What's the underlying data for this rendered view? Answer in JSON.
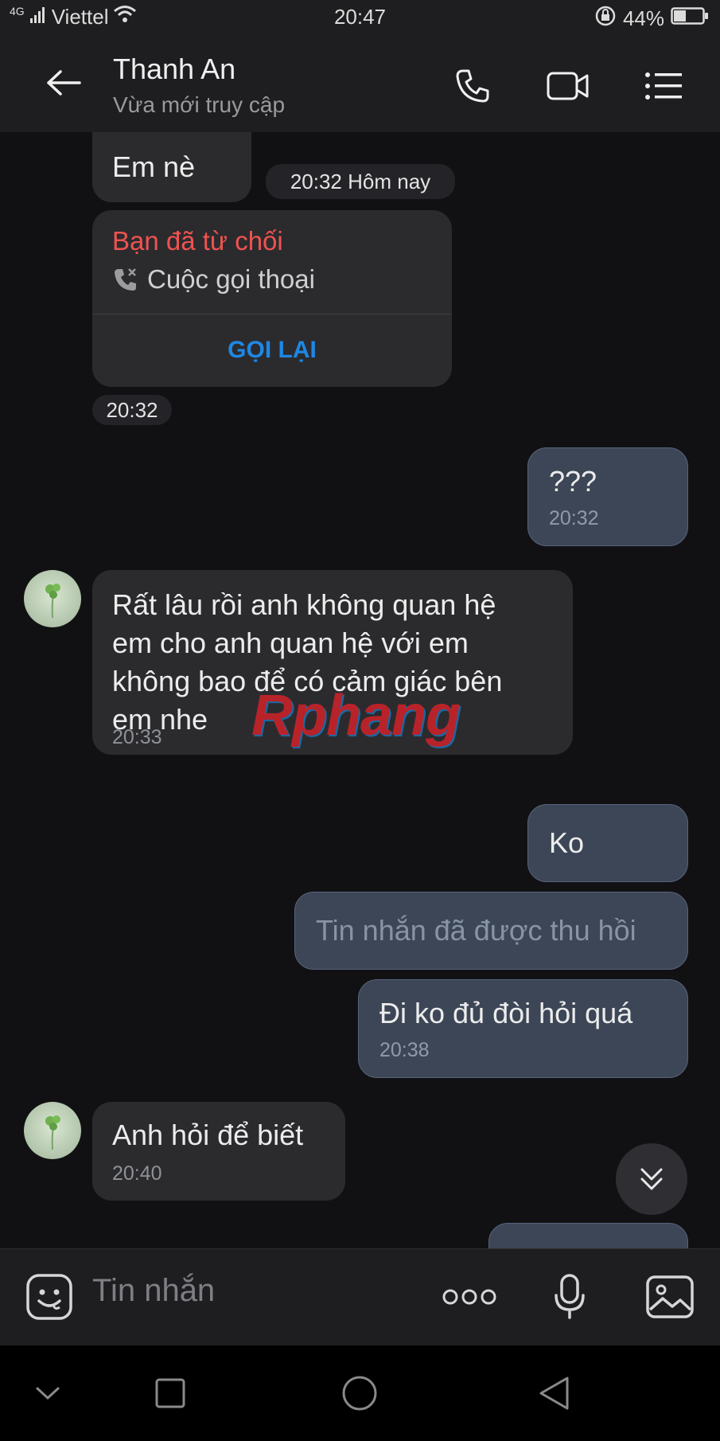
{
  "status_bar": {
    "network": "4G",
    "carrier": "Viettel",
    "time": "20:47",
    "battery": "44%",
    "battery_level": 0.44
  },
  "header": {
    "contact_name": "Thanh An",
    "contact_status": "Vừa mới truy cập"
  },
  "messages": {
    "em_ne": {
      "text": "Em nè"
    },
    "date_pill": "20:32 Hôm nay",
    "call": {
      "title": "Bạn đã từ chối",
      "type": "Cuộc gọi thoại",
      "action": "GỌI LẠI",
      "time": "20:32"
    },
    "m1": {
      "text": "???",
      "time": "20:32"
    },
    "m2": {
      "text_lines": [
        "Rất lâu rồi anh không quan hệ",
        "em cho anh quan hệ với em",
        "không bao để có cảm giác bên",
        "em nhe"
      ],
      "time": "20:33"
    },
    "m3": {
      "text": "Ko"
    },
    "m4": {
      "text": "Tin nhắn đã được thu hồi"
    },
    "m5": {
      "text": "Đi ko đủ đòi hỏi quá",
      "time": "20:38"
    },
    "m6": {
      "text": "Anh hỏi để biết",
      "time": "20:40"
    }
  },
  "watermark": "Rphang",
  "composer": {
    "placeholder": "Tin nhắn"
  },
  "colors": {
    "accent_red": "#ef5350",
    "accent_blue": "#1e88e5",
    "outgoing_bubble": "#3c4656",
    "incoming_bubble": "#2b2b2e"
  },
  "icons": [
    "back-arrow-icon",
    "phone-icon",
    "video-call-icon",
    "menu-list-icon",
    "missed-call-icon",
    "emoji-icon",
    "more-dots-icon",
    "microphone-icon",
    "image-icon",
    "scroll-down-icon",
    "nav-back-icon",
    "nav-home-icon",
    "nav-recent-icon",
    "nav-down-icon"
  ]
}
